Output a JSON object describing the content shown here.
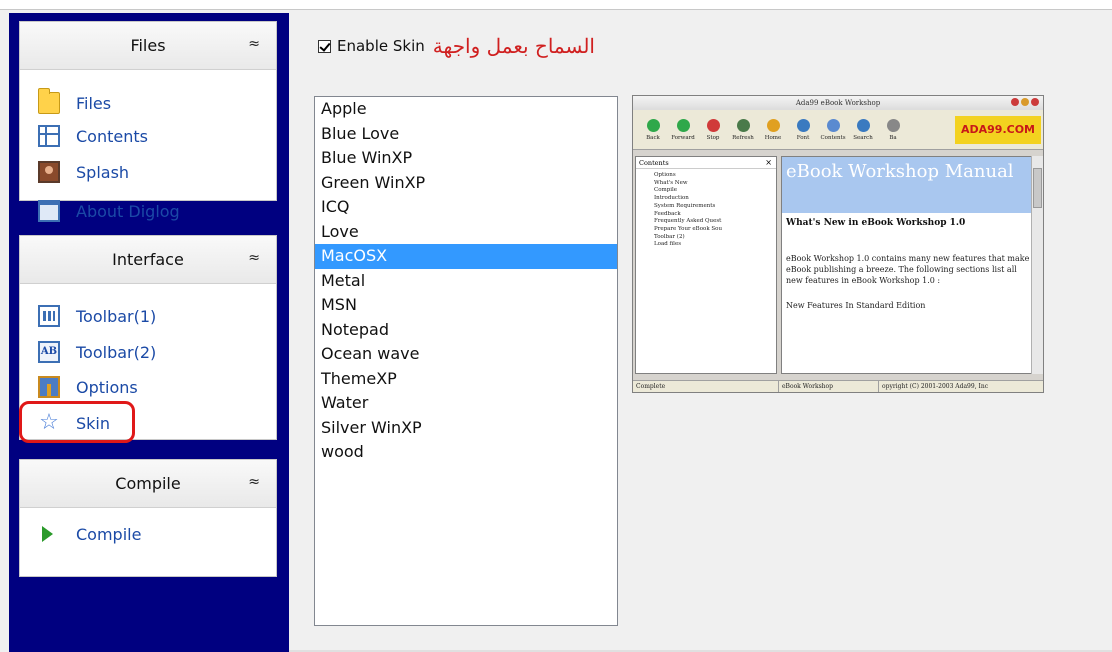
{
  "sidebar": {
    "files": {
      "title": "Files",
      "items": [
        {
          "label": "Files",
          "icon": "folder-icon"
        },
        {
          "label": "Contents",
          "icon": "contents-icon"
        },
        {
          "label": "Splash",
          "icon": "splash-icon"
        },
        {
          "label": "About Diglog",
          "icon": "about-icon"
        }
      ]
    },
    "interface": {
      "title": "Interface",
      "items": [
        {
          "label": "Toolbar(1)",
          "icon": "toolbar-icon"
        },
        {
          "label": "Toolbar(2)",
          "icon": "ab-icon"
        },
        {
          "label": "Options",
          "icon": "options-icon"
        },
        {
          "label": "Skin",
          "icon": "star-icon"
        }
      ]
    },
    "compile": {
      "title": "Compile",
      "items": [
        {
          "label": "Compile",
          "icon": "play-icon"
        }
      ]
    },
    "collapse_glyph": "≈"
  },
  "enable_skin": {
    "label": "Enable Skin",
    "checked": true,
    "annotation_ar": "السماح بعمل واجهة"
  },
  "skins": {
    "items": [
      "Apple",
      "Blue Love",
      "Blue WinXP",
      "Green WinXP",
      "ICQ",
      "Love",
      "MacOSX",
      "Metal",
      "MSN",
      "Notepad",
      "Ocean wave",
      "ThemeXP",
      "Water",
      "Silver WinXP",
      "wood"
    ],
    "selected": "MacOSX"
  },
  "preview": {
    "title": "Ada99 eBook Workshop",
    "toolbar": [
      "Back",
      "Forward",
      "Stop",
      "Refresh",
      "Home",
      "Font",
      "Contents",
      "Search",
      "Ba"
    ],
    "logo": "ADA99.COM",
    "contents_header": "Contents",
    "tree": [
      "Options",
      "What's New",
      "Compile",
      "Introduction",
      "System Requirements",
      "Feedback",
      "Frequently Asked Quest",
      "Prepare Your eBook Sou",
      "Toolbar (2)",
      "Load files"
    ],
    "banner": "eBook Workshop Manual",
    "subtitle": "What's New in eBook Workshop 1.0",
    "para1": "eBook Workshop 1.0 contains many new features that make eBook publishing a breeze. The following sections list all new features in eBook Workshop 1.0 :",
    "para2": "New Features In Standard Edition",
    "status": [
      "Complete",
      "eBook Workshop",
      "opyright (C) 2001-2003 Ada99, Inc"
    ]
  },
  "colors": {
    "sidebar_bg": "#000080",
    "selection": "#3399ff",
    "highlight": "#e01818"
  }
}
